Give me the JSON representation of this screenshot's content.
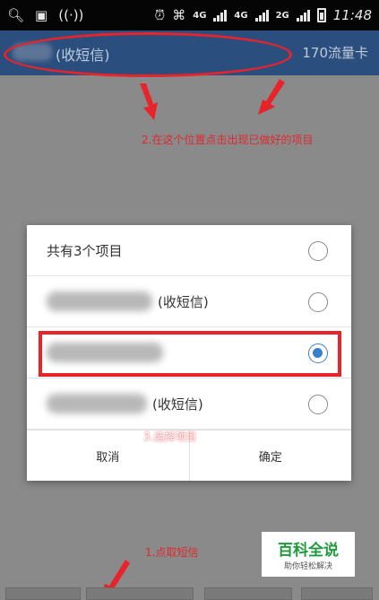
{
  "status_bar": {
    "time": "11:48",
    "signal_1": "4G",
    "signal_2": "4G",
    "signal_3": "2G"
  },
  "app_bar": {
    "sms_label": "(收短信)",
    "balance": "170流量卡"
  },
  "annotations": {
    "step1": "1.点取短信",
    "step2": "2.在这个位置点击出现已做好的项目",
    "step3": "3.选择项目"
  },
  "dialog": {
    "title": "共有3个项目",
    "options": [
      {
        "label": "(收短信)",
        "selected": false
      },
      {
        "label": "",
        "selected": true
      },
      {
        "label": "(收短信)",
        "selected": false
      }
    ],
    "cancel_label": "取消",
    "ok_label": "确定"
  },
  "watermark": {
    "title": "百科全说",
    "subtitle": "助你轻松解决"
  },
  "colors": {
    "accent_red": "#e8232a",
    "app_bar": "#2a4e7e",
    "radio_selected": "#3a7fc9"
  }
}
